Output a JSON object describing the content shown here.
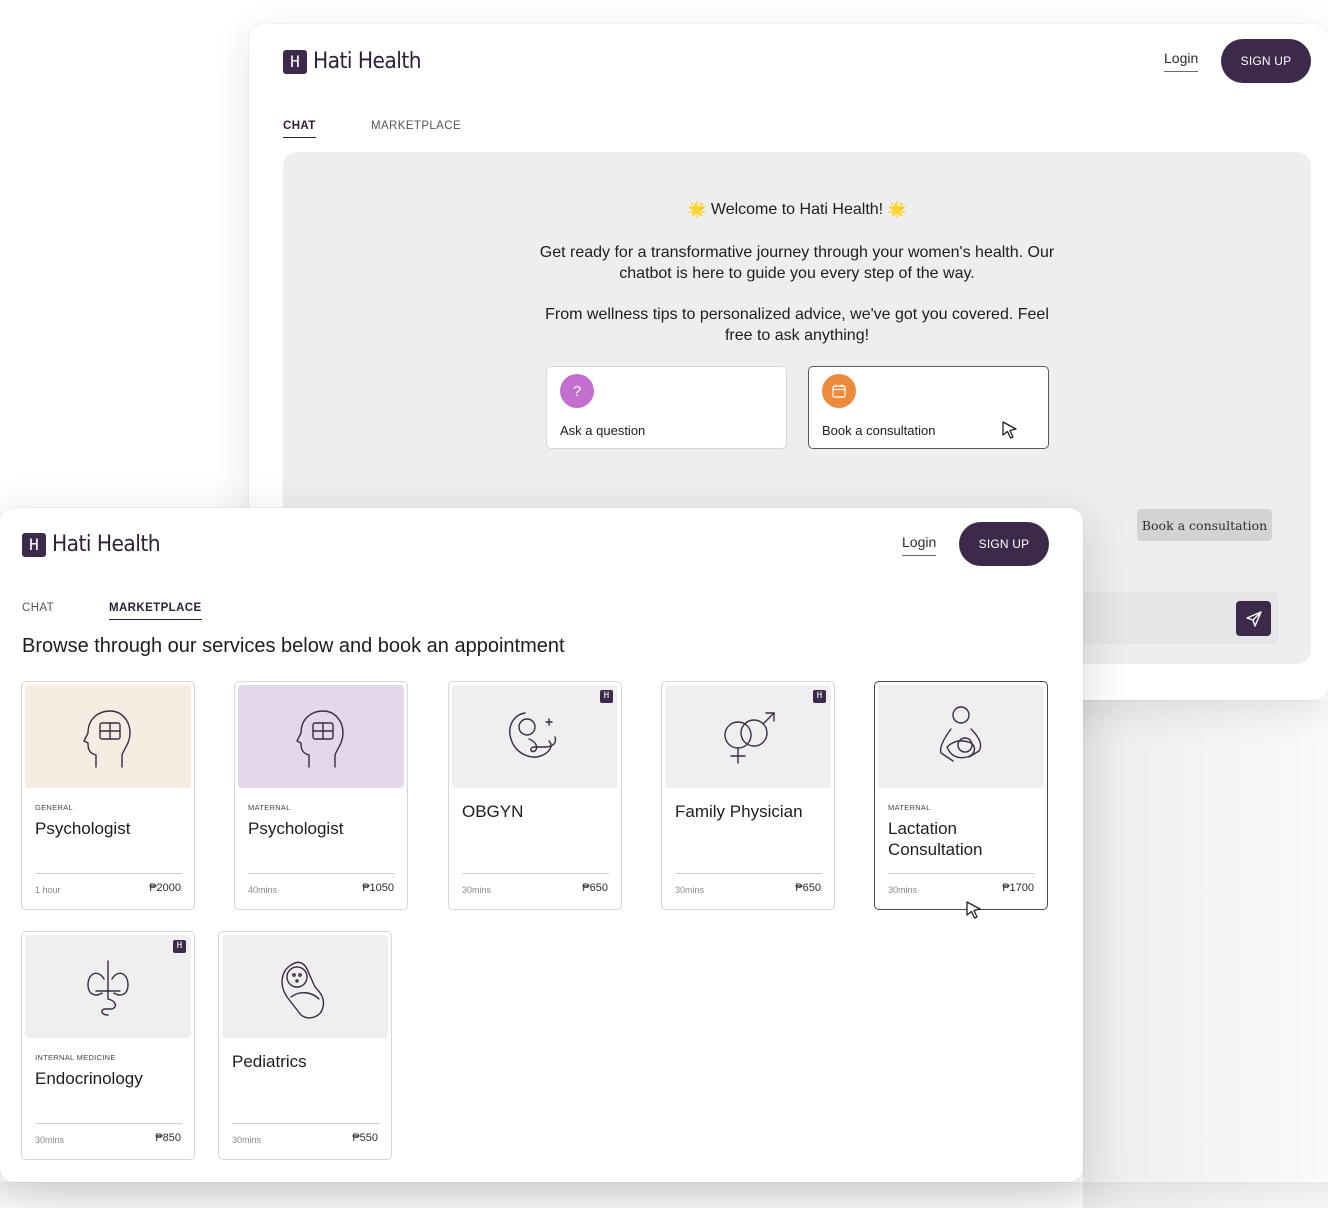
{
  "brand": {
    "logo_mark": "H",
    "name": "Hati Health",
    "primary_color": "#3d2a4a"
  },
  "chat_window": {
    "login": "Login",
    "signup": "SIGN UP",
    "tabs": [
      {
        "label": "CHAT",
        "active": true
      },
      {
        "label": "MARKETPLACE",
        "active": false
      }
    ],
    "welcome": {
      "star": "🌟",
      "title": "Welcome to Hati Health!"
    },
    "intro_1": "Get ready for a transformative journey through your women's health. Our chatbot is here to guide you every step of the way.",
    "intro_2": "From wellness tips to personalized advice, we've got you covered. Feel free to ask anything!",
    "actions": [
      {
        "label": "Ask a question",
        "icon": "question-icon",
        "glyph": "?",
        "color": "#c46fd0"
      },
      {
        "label": "Book a consultation",
        "icon": "calendar-icon",
        "color": "#ee8a3c"
      }
    ],
    "sent_chip": "Book a consultation",
    "send_icon": "send-icon"
  },
  "marketplace_window": {
    "login": "Login",
    "signup": "SIGN UP",
    "tabs": [
      {
        "label": "CHAT",
        "active": false
      },
      {
        "label": "MARKETPLACE",
        "active": true
      }
    ],
    "heading": "Browse through our services below and book an appointment",
    "services": [
      {
        "category": "GENERAL",
        "title": "Psychologist",
        "duration": "1 hour",
        "price": "₱2000",
        "icon": "brain-puzzle-icon",
        "bg": "#f6ece2",
        "badge": ""
      },
      {
        "category": "MATERNAL",
        "title": "Psychologist",
        "duration": "40mins",
        "price": "₱1050",
        "icon": "brain-puzzle-icon",
        "bg": "#e3d8ea",
        "badge": ""
      },
      {
        "category": "",
        "title": "OBGYN",
        "duration": "30mins",
        "price": "₱650",
        "icon": "fetus-icon",
        "bg": "#efefef",
        "badge": "H"
      },
      {
        "category": "",
        "title": "Family Physician",
        "duration": "30mins",
        "price": "₱650",
        "icon": "gender-symbols-icon",
        "bg": "#efefef",
        "badge": "H"
      },
      {
        "category": "MATERNAL",
        "title": "Lactation Consultation",
        "duration": "30mins",
        "price": "₱1700",
        "icon": "mother-baby-icon",
        "bg": "#efefef",
        "badge": ""
      },
      {
        "category": "INTERNAL MEDICINE",
        "title": "Endocrinology",
        "duration": "30mins",
        "price": "₱850",
        "icon": "thyroid-icon",
        "bg": "#efefef",
        "badge": "H"
      },
      {
        "category": "",
        "title": "Pediatrics",
        "duration": "30mins",
        "price": "₱550",
        "icon": "swaddled-baby-icon",
        "bg": "#efefef",
        "badge": ""
      }
    ]
  }
}
